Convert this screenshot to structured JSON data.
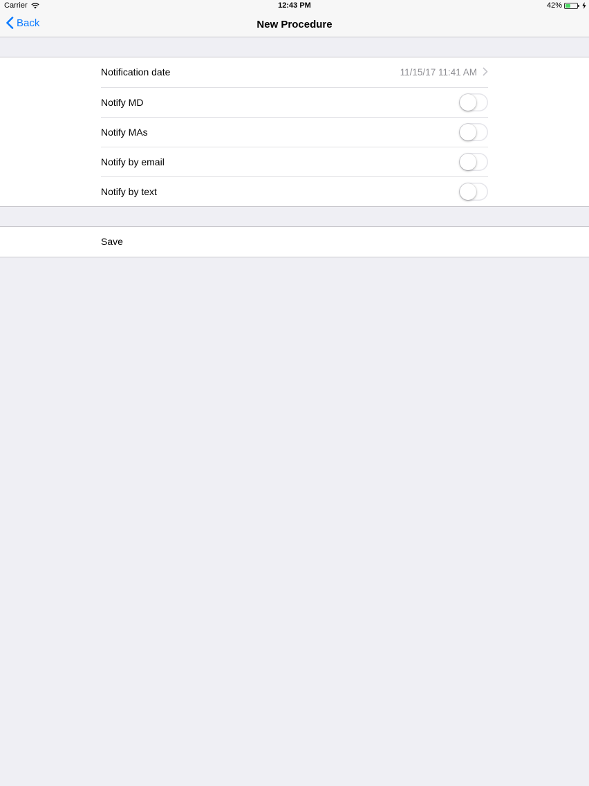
{
  "status_bar": {
    "carrier": "Carrier",
    "time": "12:43 PM",
    "battery": "42%",
    "battery_level": 0.42
  },
  "nav": {
    "back_label": "Back",
    "title": "New Procedure"
  },
  "settings": {
    "notification_date_label": "Notification date",
    "notification_date_value": "11/15/17 11:41 AM",
    "notify_md_label": "Notify MD",
    "notify_mas_label": "Notify MAs",
    "notify_email_label": "Notify by email",
    "notify_text_label": "Notify by text"
  },
  "toggles": {
    "notify_md": false,
    "notify_mas": false,
    "notify_email": false,
    "notify_text": false
  },
  "actions": {
    "save_label": "Save"
  },
  "colors": {
    "accent": "#0a7aff",
    "background": "#efeff4",
    "battery_fill": "#4cd964"
  }
}
